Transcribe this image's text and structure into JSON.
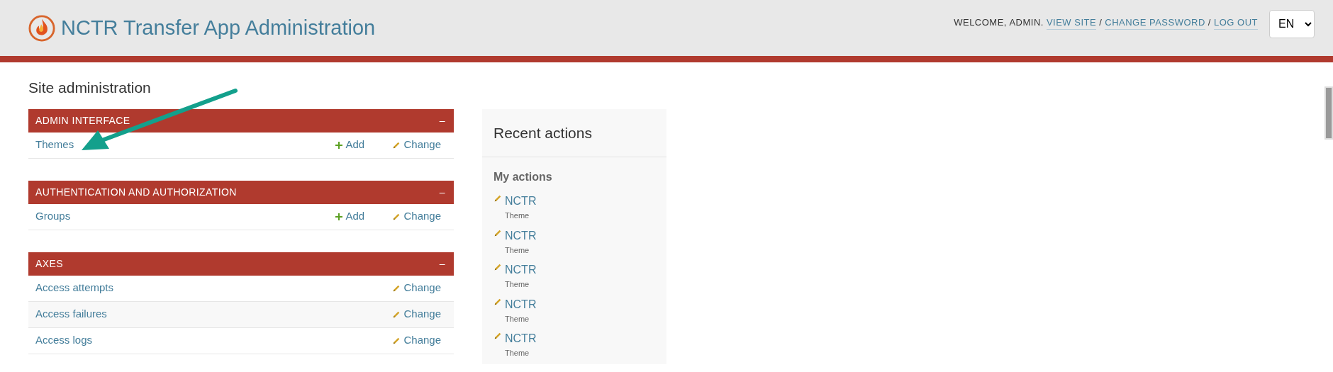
{
  "header": {
    "title": "NCTR Transfer App Administration",
    "welcome": "WELCOME, ADMIN.",
    "links": [
      "VIEW SITE",
      "CHANGE PASSWORD",
      "LOG OUT"
    ],
    "separators": [
      "/",
      "/"
    ],
    "language": "EN"
  },
  "page_title": "Site administration",
  "modules": [
    {
      "name": "ADMIN INTERFACE",
      "toggle": "–",
      "rows": [
        {
          "name": "Themes",
          "add": "Add",
          "change": "Change"
        }
      ]
    },
    {
      "name": "AUTHENTICATION AND AUTHORIZATION",
      "toggle": "–",
      "rows": [
        {
          "name": "Groups",
          "add": "Add",
          "change": "Change"
        }
      ]
    },
    {
      "name": "AXES",
      "toggle": "–",
      "rows": [
        {
          "name": "Access attempts",
          "change": "Change"
        },
        {
          "name": "Access failures",
          "change": "Change"
        },
        {
          "name": "Access logs",
          "change": "Change"
        }
      ]
    }
  ],
  "recent": {
    "title": "Recent actions",
    "subtitle": "My actions",
    "items": [
      {
        "name": "NCTR",
        "type": "Theme"
      },
      {
        "name": "NCTR",
        "type": "Theme"
      },
      {
        "name": "NCTR",
        "type": "Theme"
      },
      {
        "name": "NCTR",
        "type": "Theme"
      },
      {
        "name": "NCTR",
        "type": "Theme"
      }
    ]
  }
}
